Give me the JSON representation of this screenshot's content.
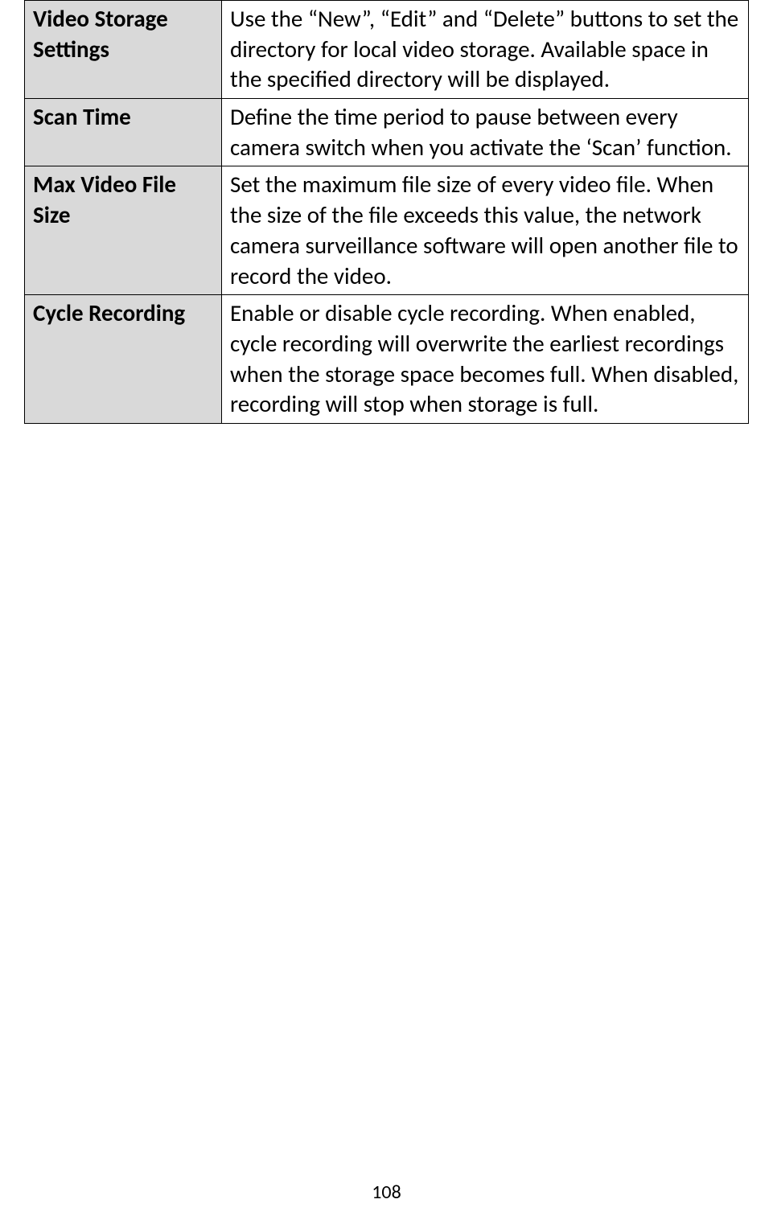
{
  "table": {
    "rows": [
      {
        "label": "Video Storage Settings",
        "description": "Use the “New”, “Edit” and “Delete” buttons to set the directory for local video storage. Available space in the specified directory will be displayed."
      },
      {
        "label": "Scan Time",
        "description": "Define the time period to pause between every camera switch when you activate the ‘Scan’ function."
      },
      {
        "label": "Max Video File Size",
        "description": "Set the maximum file size of every video file. When the size of the file exceeds this value, the network camera surveillance software will open another file to record the video."
      },
      {
        "label": "Cycle Recording",
        "description": "Enable or disable cycle recording. When enabled, cycle recording will overwrite the earliest recordings when the storage space becomes full. When disabled, recording will stop when storage is full."
      }
    ]
  },
  "page_number": "108"
}
